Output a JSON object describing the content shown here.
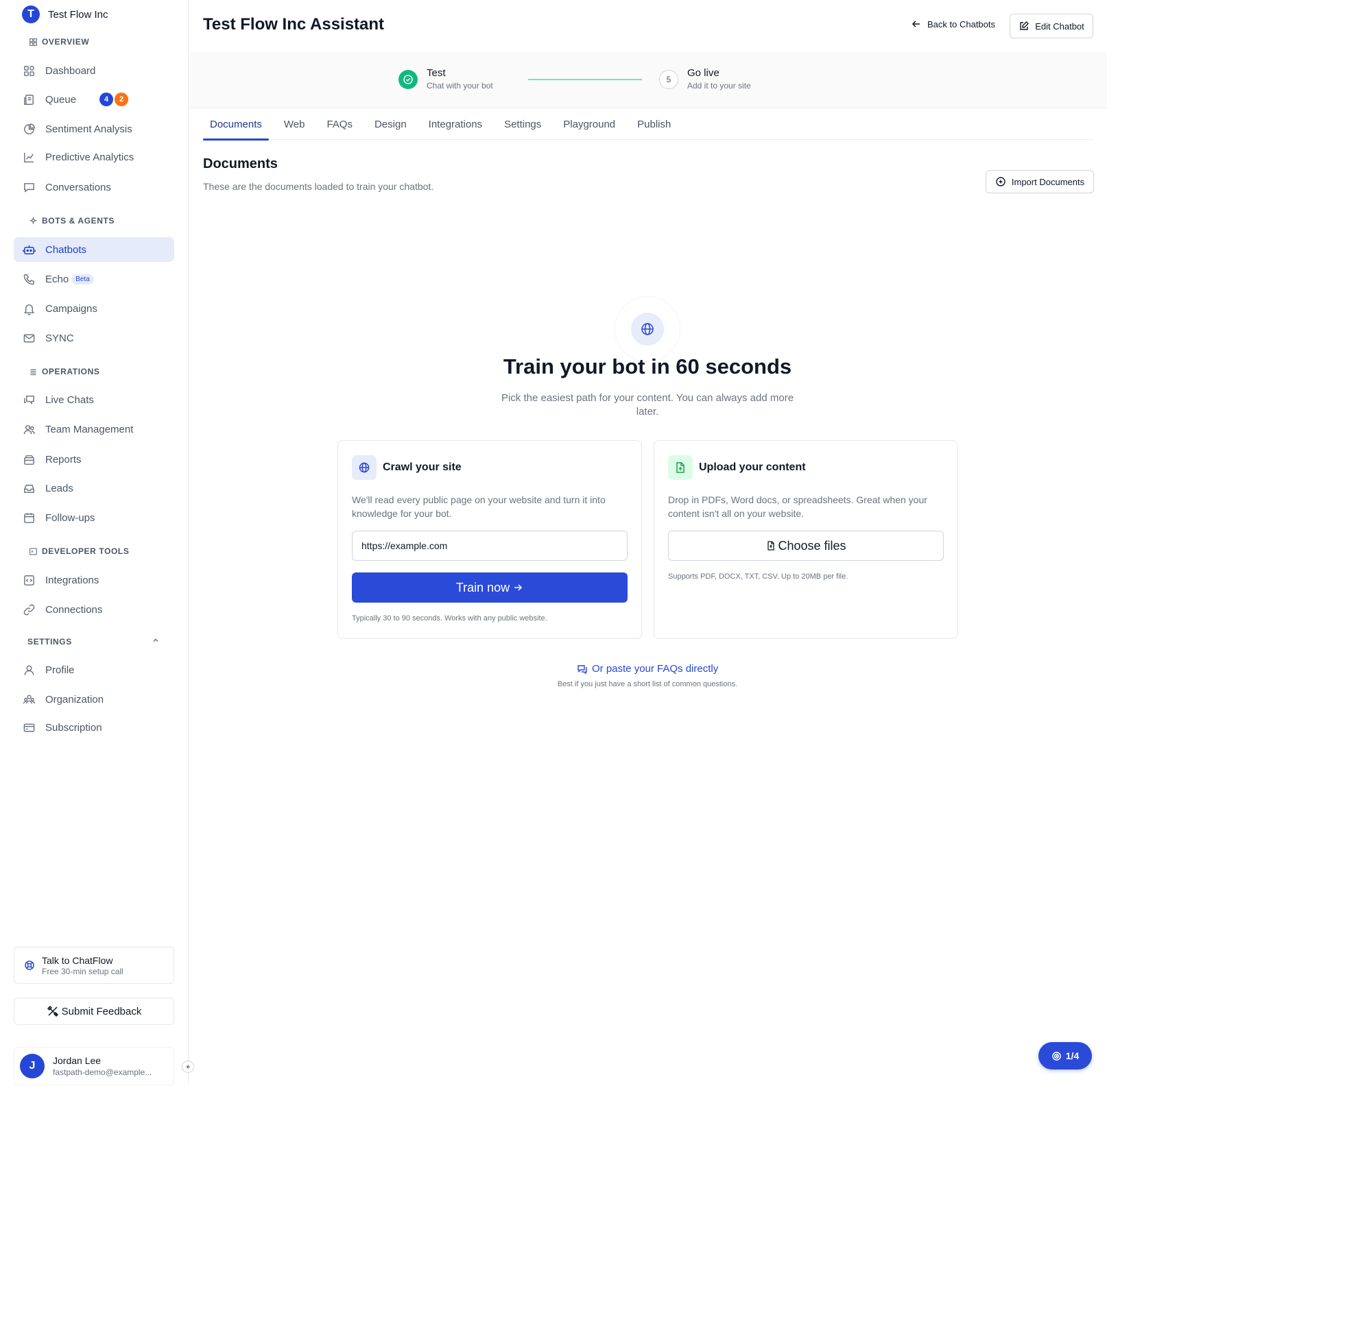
{
  "org": {
    "initial": "T",
    "name": "Test Flow Inc"
  },
  "sidebar": {
    "sections": {
      "overview": "OVERVIEW",
      "bots": "BOTS & AGENTS",
      "operations": "OPERATIONS",
      "developer": "DEVELOPER TOOLS",
      "settings": "SETTINGS"
    },
    "items": {
      "dashboard": "Dashboard",
      "queue": "Queue",
      "queue_badge_1": "4",
      "queue_badge_2": "2",
      "sentiment": "Sentiment Analysis",
      "predictive": "Predictive Analytics",
      "conversations": "Conversations",
      "chatbots": "Chatbots",
      "echo": "Echo",
      "echo_badge": "Beta",
      "campaigns": "Campaigns",
      "sync": "SYNC",
      "live_chats": "Live Chats",
      "team": "Team Management",
      "reports": "Reports",
      "leads": "Leads",
      "followups": "Follow-ups",
      "integrations": "Integrations",
      "connections": "Connections",
      "profile": "Profile",
      "organization": "Organization",
      "subscription": "Subscription"
    },
    "talk": {
      "title": "Talk to ChatFlow",
      "subtitle": "Free 30-min setup call"
    },
    "feedback_label": "Submit Feedback",
    "user": {
      "initial": "J",
      "name": "Jordan Lee",
      "email": "fastpath-demo@example..."
    }
  },
  "header": {
    "title": "Test Flow Inc Assistant",
    "back_label": "Back to Chatbots",
    "edit_label": "Edit Chatbot"
  },
  "stepper": {
    "step1_title": "Test",
    "step1_sub": "Chat with your bot",
    "step2_number": "5",
    "step2_title": "Go live",
    "step2_sub": "Add it to your site"
  },
  "tabs": [
    "Documents",
    "Web",
    "FAQs",
    "Design",
    "Integrations",
    "Settings",
    "Playground",
    "Publish"
  ],
  "documents": {
    "title": "Documents",
    "description": "These are the documents loaded to train your chatbot.",
    "import_label": "Import Documents"
  },
  "hero": {
    "title": "Train your bot in 60 seconds",
    "subtitle": "Pick the easiest path for your content. You can always add more later."
  },
  "crawl": {
    "title": "Crawl your site",
    "text": "We'll read every public page on your website and turn it into knowledge for your bot.",
    "url_value": "https://example.com",
    "button": "Train now",
    "footnote": "Typically 30 to 90 seconds. Works with any public website."
  },
  "upload": {
    "title": "Upload your content",
    "text": "Drop in PDFs, Word docs, or spreadsheets. Great when your content isn't all on your website.",
    "button": "Choose files",
    "footnote": "Supports PDF, DOCX, TXT, CSV. Up to 20MB per file."
  },
  "faq": {
    "link": "Or paste your FAQs directly",
    "sub": "Best if you just have a short list of common questions."
  },
  "progress": {
    "label": "1/4"
  },
  "colors": {
    "brand": "#2547d6",
    "success": "#10b981",
    "badge_orange": "#f97316"
  }
}
